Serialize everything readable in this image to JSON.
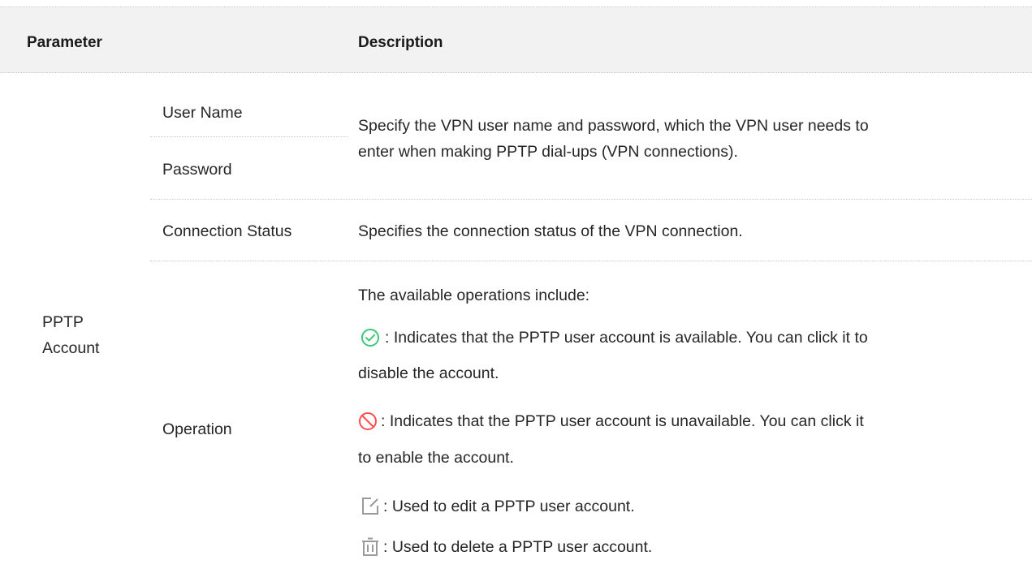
{
  "header": {
    "col_parameter": "Parameter",
    "col_description": "Description"
  },
  "group": {
    "label_line1": "PPTP",
    "label_line2": "Account"
  },
  "rows": {
    "user_name": "User Name",
    "password": "Password",
    "credentials_desc_line1": "Specify the VPN user name and password, which the VPN user needs to",
    "credentials_desc_line2": "enter when making PPTP dial-ups (VPN connections).",
    "connection_status": "Connection Status",
    "connection_status_desc": "Specifies the connection status of the VPN connection.",
    "operation": "Operation",
    "operation_intro": "The available operations include:",
    "available_line1": ": Indicates that the PPTP user account is available. You can click it to",
    "available_line2": "disable the account.",
    "unavailable_line1": ": Indicates that the PPTP user account is unavailable. You can click it",
    "unavailable_line2": "to enable the account.",
    "edit_desc": ": Used to edit a PPTP user account.",
    "delete_desc": ": Used to delete a PPTP user account."
  },
  "icons": {
    "available": "check-circle-icon",
    "unavailable": "prohibited-icon",
    "edit": "edit-icon",
    "delete": "trash-icon"
  },
  "colors": {
    "available": "#3cc77a",
    "unavailable": "#ff4d4f",
    "edit_delete": "#9a9a9a",
    "header_bg": "#f2f2f2"
  }
}
